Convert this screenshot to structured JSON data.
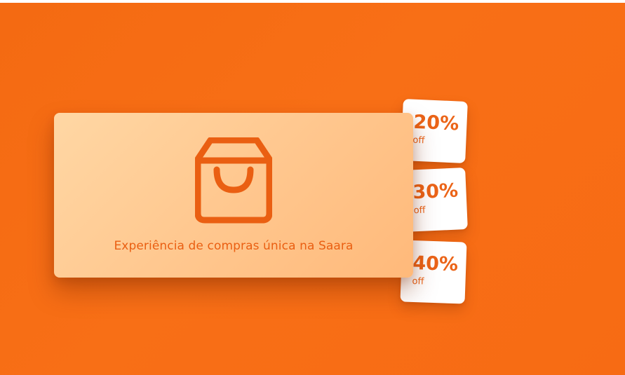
{
  "promo": {
    "caption": "Experiência de compras única na Saara",
    "icon": "shopping-bag-icon",
    "colors": {
      "background": "#f86f16",
      "card_start": "#ffd7a4",
      "card_end": "#ffb97a",
      "accent": "#ea5f12",
      "coupon": "#ffffff"
    }
  },
  "coupons": [
    {
      "percent": "20%",
      "label": "off"
    },
    {
      "percent": "30%",
      "label": "off"
    },
    {
      "percent": "40%",
      "label": "off"
    }
  ]
}
